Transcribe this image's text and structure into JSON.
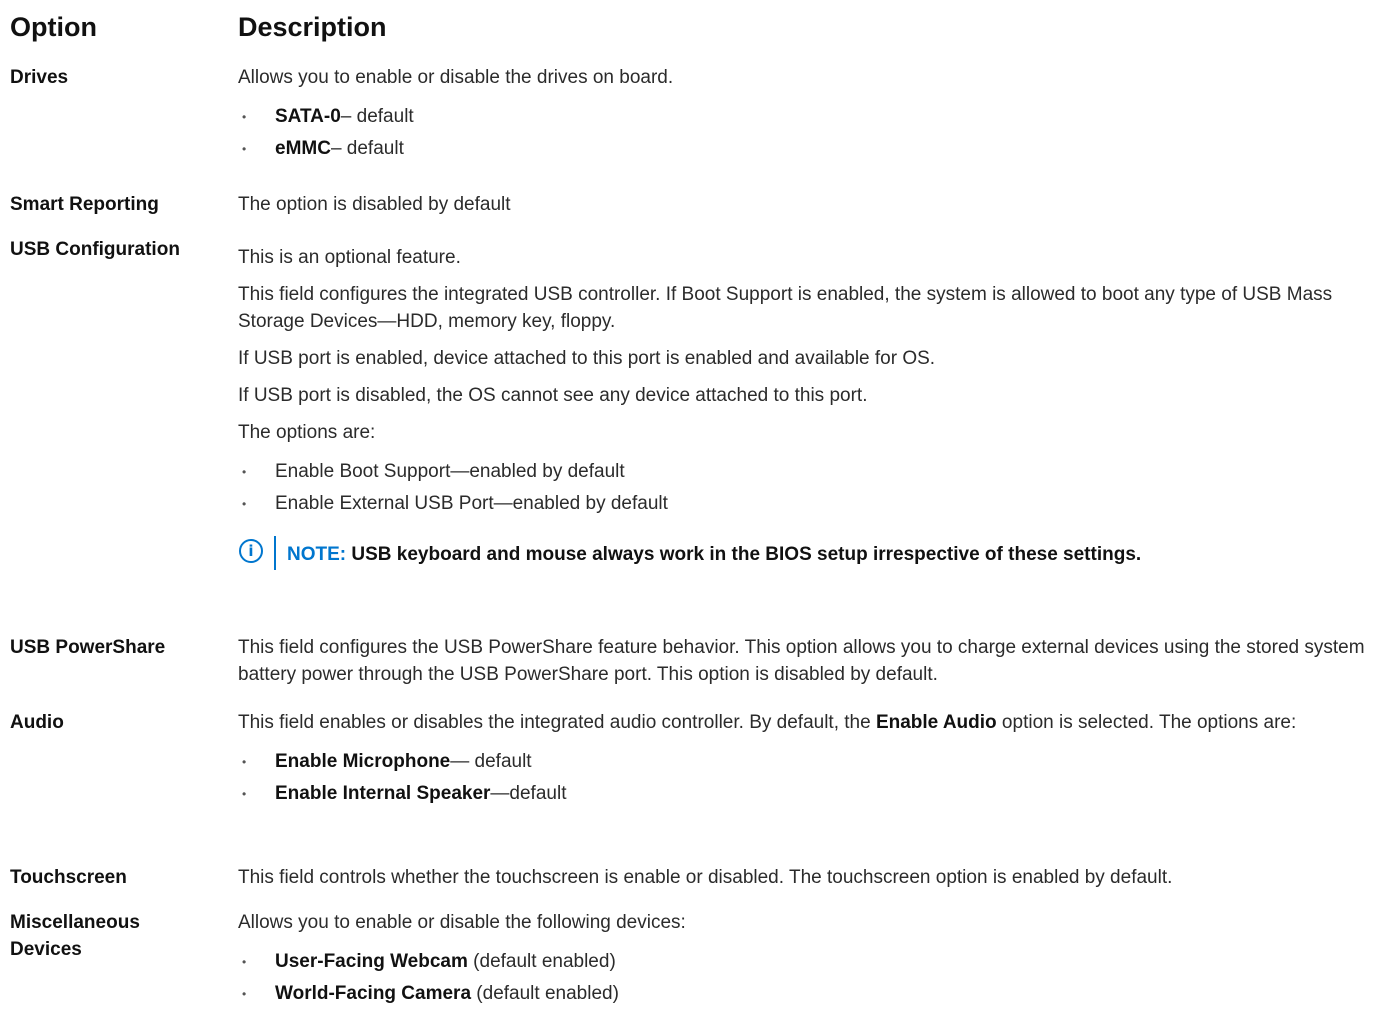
{
  "header": {
    "option": "Option",
    "description": "Description"
  },
  "drives": {
    "option": "Drives",
    "text": "Allows you to enable or disable the drives on board.",
    "items": [
      {
        "bold": "SATA-0",
        "rest": "– default"
      },
      {
        "bold": "eMMC",
        "rest": "– default"
      }
    ]
  },
  "smart": {
    "option": "Smart Reporting",
    "text": "The option is disabled by default"
  },
  "usb": {
    "option": "USB Configuration",
    "p1": "This is an optional feature.",
    "p2": "This field configures the integrated USB controller. If Boot Support is enabled, the system is allowed to boot any type of USB Mass Storage Devices—HDD, memory key, floppy.",
    "p3": "If USB port is enabled, device attached to this port is enabled and available for OS.",
    "p4": "If USB port is disabled, the OS cannot see any device attached to this port.",
    "p5": "The options are:",
    "items": [
      "Enable Boot Support—enabled by default",
      "Enable External USB Port—enabled by default"
    ],
    "note_icon": "info-icon",
    "note_label": "NOTE:",
    "note_text": " USB keyboard and mouse always work in the BIOS setup irrespective of these settings."
  },
  "powershare": {
    "option": "USB PowerShare",
    "text": "This field configures the USB PowerShare feature behavior. This option allows you to charge external devices using the stored system battery power through the USB PowerShare port. This option is disabled by default."
  },
  "audio": {
    "option": "Audio",
    "text_before": "This field enables or disables the integrated audio controller. By default, the ",
    "text_bold": "Enable Audio",
    "text_after": " option is selected. The options are:",
    "items": [
      {
        "bold": "Enable Microphone",
        "rest": "— default"
      },
      {
        "bold": "Enable Internal Speaker",
        "rest": "—default"
      }
    ]
  },
  "touchscreen": {
    "option": "Touchscreen",
    "text": "This field controls whether the touchscreen is enable or disabled. The touchscreen option is enabled by default."
  },
  "misc": {
    "option": "Miscellaneous Devices",
    "text": "Allows you to enable or disable the following devices:",
    "items": [
      {
        "bold": "User-Facing Webcam",
        "rest": " (default enabled)"
      },
      {
        "bold": "World-Facing Camera",
        "rest": " (default enabled)"
      }
    ]
  },
  "colors": {
    "accent": "#0076ce",
    "text": "#2b2b2b"
  }
}
